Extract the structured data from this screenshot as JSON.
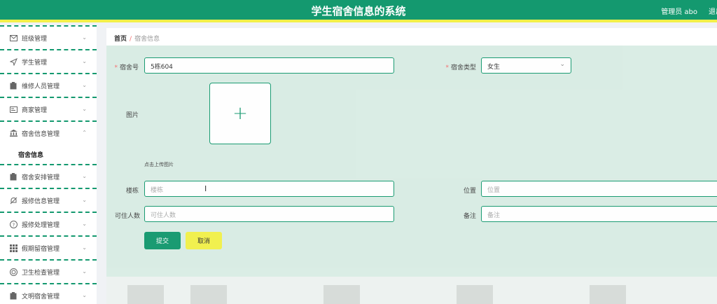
{
  "header": {
    "title": "学生宿舍信息的系统",
    "user": "管理员 abo",
    "logout": "退出"
  },
  "sidebar": {
    "items": [
      {
        "label": "班级管理",
        "icon": "mail-icon"
      },
      {
        "label": "学生管理",
        "icon": "send-icon"
      },
      {
        "label": "维修人员管理",
        "icon": "clipboard-icon"
      },
      {
        "label": "商家管理",
        "icon": "id-card-icon"
      },
      {
        "label": "宿舍信息管理",
        "icon": "bank-icon",
        "expanded": true
      },
      {
        "label": "宿舍安排管理",
        "icon": "clipboard-icon"
      },
      {
        "label": "报修信息管理",
        "icon": "mute-bell-icon"
      },
      {
        "label": "报修处理管理",
        "icon": "question-icon"
      },
      {
        "label": "假期留宿管理",
        "icon": "grid-icon"
      },
      {
        "label": "卫生检查管理",
        "icon": "circle-icon"
      },
      {
        "label": "文明宿舍管理",
        "icon": "clipboard-icon"
      }
    ],
    "submenu": {
      "label": "宿舍信息"
    }
  },
  "breadcrumb": {
    "home": "首页",
    "separator": "/",
    "current": "宿舍信息"
  },
  "form": {
    "dorm_no": {
      "label": "宿舍号",
      "value": "5栋604"
    },
    "dorm_type": {
      "label": "宿舍类型",
      "value": "女生"
    },
    "image": {
      "label": "图片",
      "tip": "点击上传图片"
    },
    "building": {
      "label": "楼栋",
      "placeholder": "楼栋"
    },
    "location": {
      "label": "位置",
      "placeholder": "位置"
    },
    "capacity": {
      "label": "可住人数",
      "placeholder": "可住人数"
    },
    "note": {
      "label": "备注",
      "placeholder": "备注"
    },
    "submit": "提交",
    "cancel": "取消"
  },
  "colors": {
    "primary": "#14996f",
    "accent": "#f2f04a",
    "required": "#f56c6c"
  }
}
